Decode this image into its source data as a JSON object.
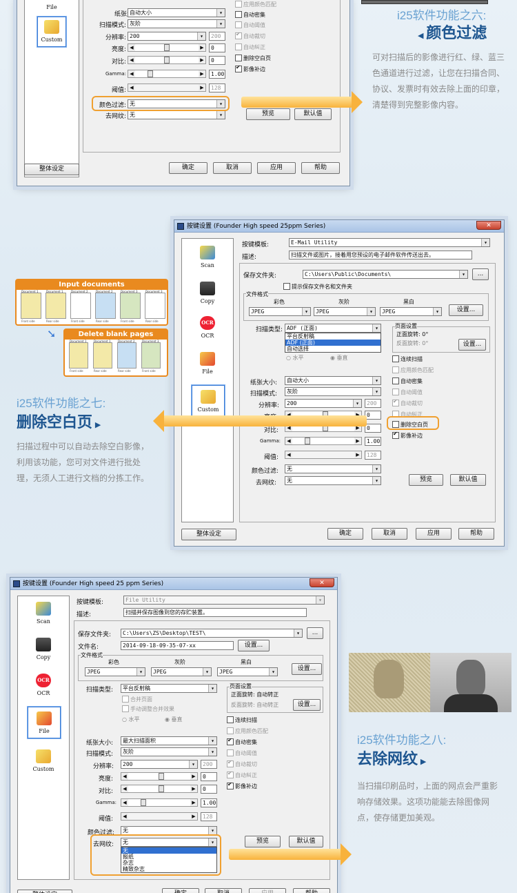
{
  "features": {
    "f6": {
      "subtitle": "i25软件功能之六:",
      "title": "颜色过滤",
      "desc": "可对扫描后的影像进行红、绿、蓝三色通道进行过滤，让您在扫描合同、协议、发票时有效去除上面的印章，清楚得到完整影像内容。"
    },
    "f7": {
      "subtitle": "i25软件功能之七:",
      "title": "删除空白页",
      "desc": "扫描过程中可以自动去除空白影像，利用该功能，您可对文件进行批处理，无须人工进行文档的分拣工作。"
    },
    "f8": {
      "subtitle": "i25软件功能之八:",
      "title": "去除网纹",
      "desc": "当扫描印刷品时，上面的网点会严重影响存储效果。这项功能能去除图像网点，使存储更加美观。"
    }
  },
  "diagram": {
    "input": "Input documents",
    "delete": "Delete blank pages",
    "docs": [
      "Document 1",
      "Document 1",
      "Document 2",
      "Document 2",
      "Document 3",
      "Document 3"
    ],
    "sides": [
      "Front side",
      "Rear side",
      "Front side",
      "Rear side",
      "Front side",
      "Rear side"
    ]
  },
  "icons": {
    "scan": "Scan",
    "copy": "Copy",
    "ocr": "OCR",
    "file": "File",
    "custom": "Custom",
    "ocr_glyph": "OCR"
  },
  "labels": {
    "template": "按键模板:",
    "desc": "描述:",
    "savefolder": "保存文件夹:",
    "filename": "文件名:",
    "fileformat": "文件格式",
    "color": "彩色",
    "gray": "灰阶",
    "bw": "黑白",
    "settings": "设置...",
    "browse": "...",
    "scantype": "扫描类型:",
    "pagesettings": "页面设置",
    "frontrot": "正面旋转: 0°",
    "rearrot": "反面旋转: 0°",
    "frontauto": "正面旋转: 自动转正",
    "rearauto": "反面旋转: 自动转正",
    "horiz": "水平",
    "vert": "垂直",
    "merge": "合并页面",
    "manualmerge": "手动调整合并效果",
    "papersize": "纸张大小:",
    "scanmode": "扫描模式:",
    "dpi": "分辨率:",
    "brightness": "亮度:",
    "contrast": "对比:",
    "gamma": "Gamma:",
    "threshold": "阈值:",
    "colorfilter": "颜色过滤:",
    "descreen": "去网纹:"
  },
  "checks": {
    "continuous": "连续扫描",
    "colormatch": "应用颜色匹配",
    "autodensity": "自动密集",
    "autothreshold": "自动阈值",
    "autocrop": "自动裁切",
    "autodeskew": "自动糾正",
    "deleteblank": "删除空白页",
    "imagefill": "影像补边"
  },
  "values": {
    "papersize": "自动大小",
    "papersize3": "最大扫描面积",
    "scanmode": "灰阶",
    "dpi": "200",
    "dpi_dis": "200",
    "b": "0",
    "c": "0",
    "gamma": "1.00",
    "threshold": "128",
    "filter": "无",
    "descreen": "无"
  },
  "buttons": {
    "global": "整体设定",
    "ok": "确定",
    "cancel": "取消",
    "apply": "应用",
    "help": "帮助",
    "preview": "预览",
    "default": "默认值"
  },
  "win2": {
    "title": "按键设置 (Founder High speed 25ppm Series)",
    "template": "E-Mail Utility",
    "desc": "扫描文件或图片，接着用您预设的电子邮件软件传送出去。",
    "folder": "C:\\Users\\Public\\Documents\\",
    "showname": "提示保存文件名和文件夹",
    "fmt": [
      "JPEG",
      "JPEG",
      "JPEG"
    ],
    "scantype": "ADF (正面)",
    "options": [
      "平台反射稿",
      "ADF (正面)",
      "自动选择"
    ]
  },
  "win3": {
    "title": "按键设置 (Founder High speed 25 ppm Series)",
    "template": "File Utility",
    "desc": "扫描并保存图像到您的存贮装置。",
    "folder": "C:\\Users\\ZS\\Desktop\\TEST\\",
    "filename": "2014-09-18-09-35-07-xx",
    "fmt": [
      "JPEG",
      "JPEG",
      "JPEG"
    ],
    "scantype": "平台反射稿",
    "options": [
      "无",
      "报纸",
      "杂志",
      "精致杂志"
    ]
  },
  "colors": {
    "accent": "#f0a030",
    "title": "#1e5690",
    "subtitle": "#6aa2d2"
  }
}
